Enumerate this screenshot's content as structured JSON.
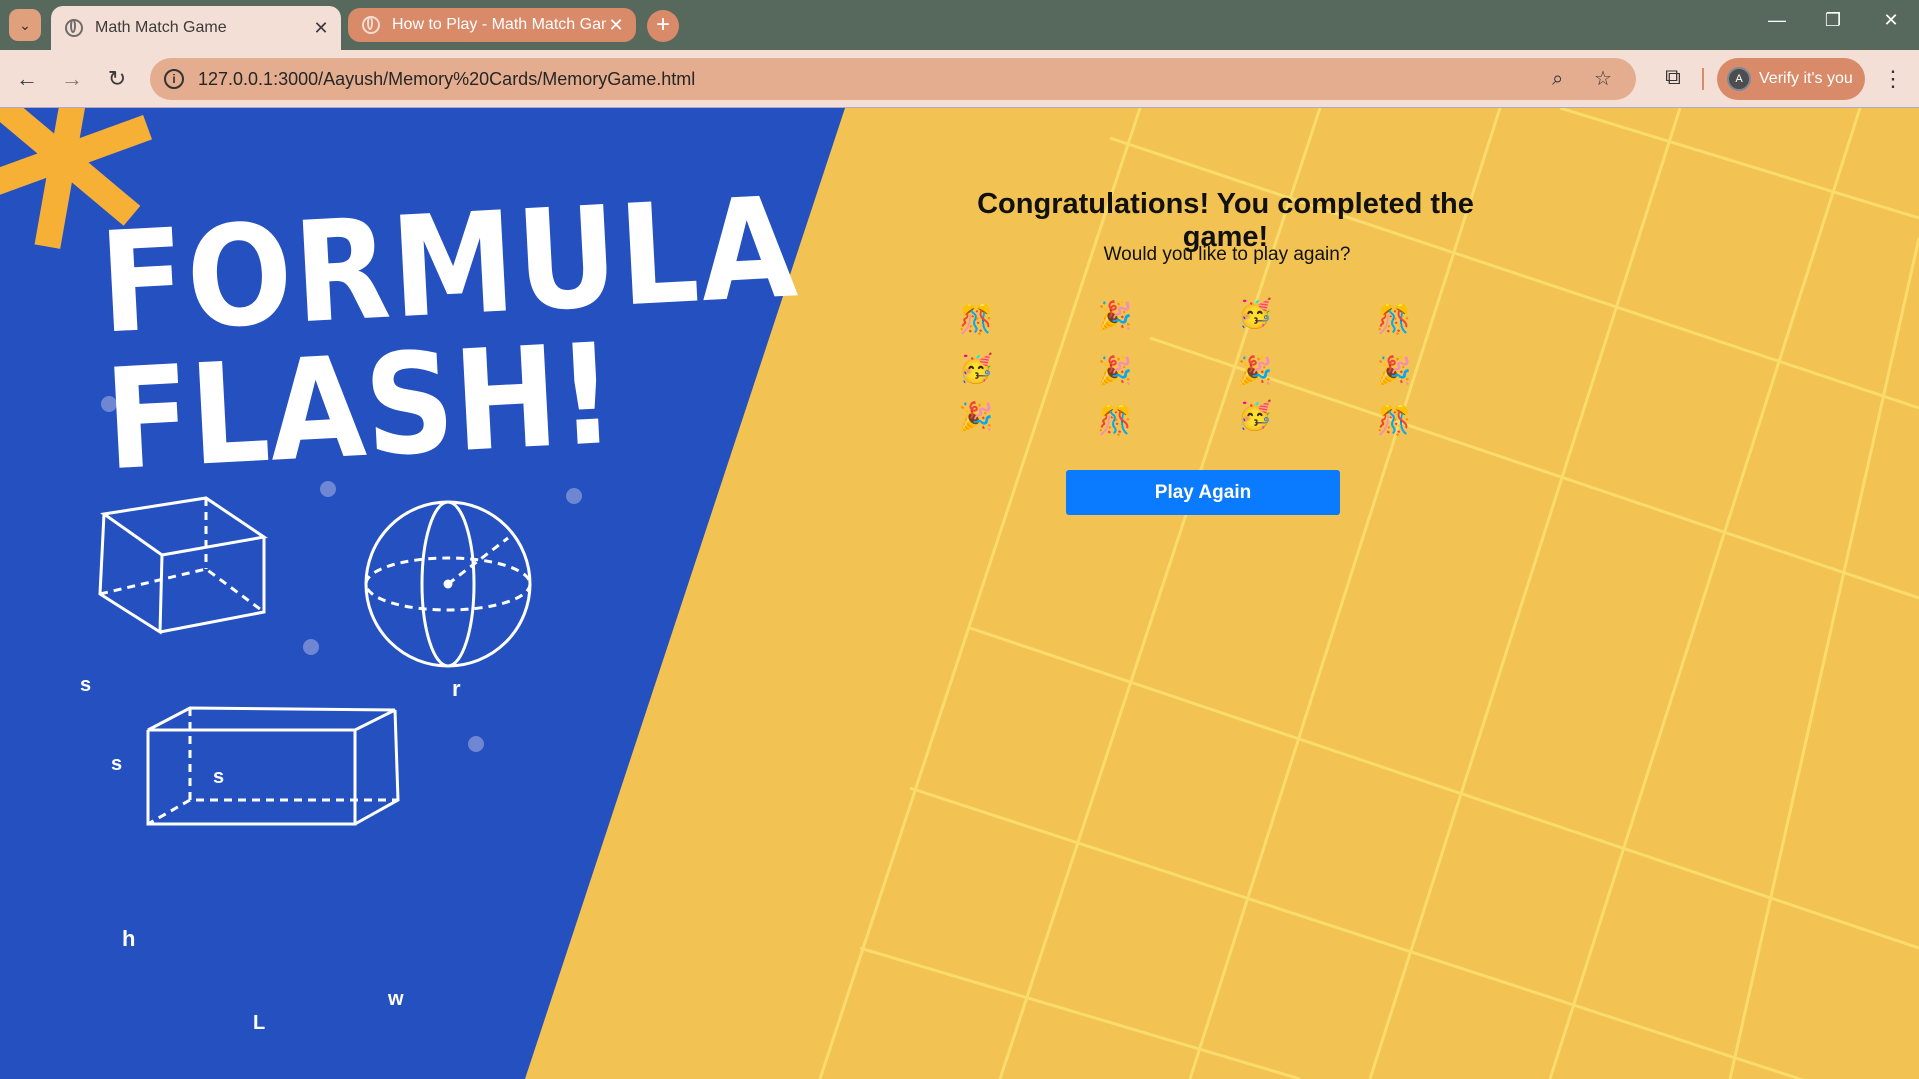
{
  "browser": {
    "tabs": [
      {
        "title": "Math Match Game",
        "active": true
      },
      {
        "title": "How to Play - Math Match Game",
        "active": false
      }
    ],
    "new_tab_label": "+",
    "url": "127.0.0.1:3000/Aayush/Memory%20Cards/MemoryGame.html",
    "profile_initial": "A",
    "profile_label": "Verify it's you",
    "icons": [
      "tab-search-icon",
      "globe-icon",
      "close-icon",
      "back-icon",
      "forward-icon",
      "reload-icon",
      "info-icon",
      "zoom-icon",
      "bookmark-star-icon",
      "extensions-icon",
      "kebab-menu-icon",
      "minimize-icon",
      "restore-icon",
      "window-close-icon"
    ]
  },
  "poster": {
    "title_line1": "FORMULA",
    "title_line2": "FLASH!",
    "cube_labels": [
      "s",
      "s",
      "s"
    ],
    "sphere_label": "r",
    "prism_labels": [
      "h",
      "L",
      "w"
    ],
    "colors": {
      "blue": "#2550c0",
      "yellow": "#f2c253",
      "accent": "#f6b035"
    }
  },
  "game": {
    "heading": "Congratulations! You completed the game!",
    "prompt": "Would you like to play again?",
    "cards": [
      [
        "🎊",
        "🎉",
        "🥳",
        "🎊"
      ],
      [
        "🥳",
        "🎉",
        "🎉",
        "🎉"
      ],
      [
        "🎉",
        "🎊",
        "🥳",
        "🎊"
      ]
    ],
    "play_again_label": "Play Again",
    "button_color": "#0a7bff"
  }
}
